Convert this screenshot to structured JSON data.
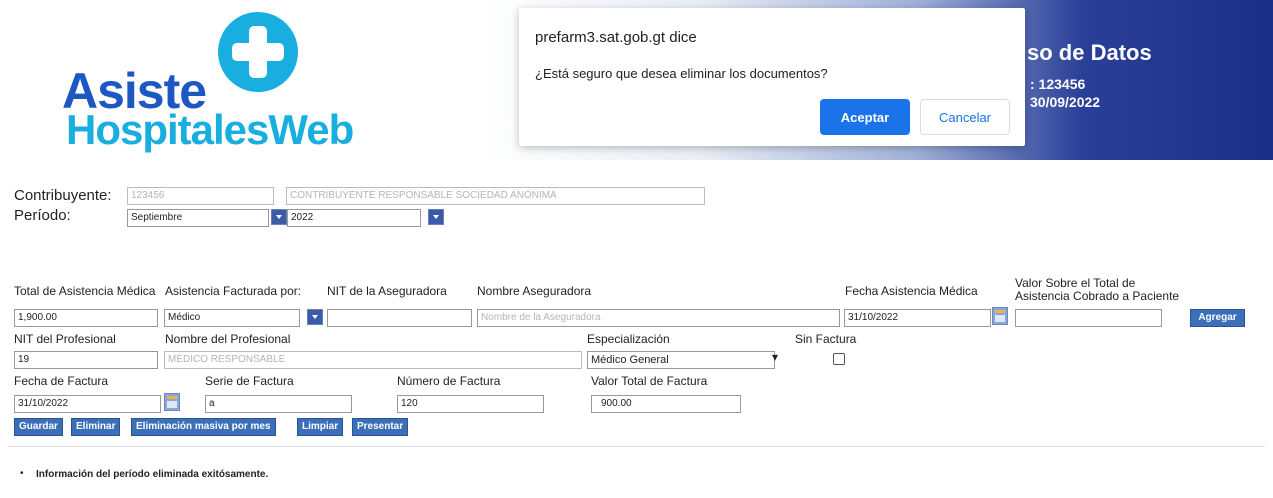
{
  "header": {
    "logo_line1": "Asiste",
    "logo_line2": "HospitalesWeb",
    "title_partial": "so de Datos",
    "line1_partial": ": 123456",
    "line2_partial": "30/09/2022"
  },
  "dialog": {
    "origin": "prefarm3.sat.gob.gt dice",
    "message": "¿Está seguro que desea eliminar los documentos?",
    "ok_label": "Aceptar",
    "cancel_label": "Cancelar"
  },
  "taxpayer": {
    "contribuyente_label": "Contribuyente:",
    "contribuyente_nit": "123456",
    "contribuyente_name": "CONTRIBUYENTE RESPONSABLE SOCIEDAD ANONIMA",
    "periodo_label": "Período:",
    "mes": "Septiembre",
    "anio": "2022"
  },
  "form": {
    "total_label": "Total de Asistencia Médica",
    "facturada_label": "Asistencia Facturada por:",
    "nit_aseg_label": "NIT de la Aseguradora",
    "nombre_aseg_label": "Nombre Aseguradora",
    "fecha_asist_label": "Fecha Asistencia Médica",
    "valor_sobre_label_1": "Valor Sobre el Total de",
    "valor_sobre_label_2": "Asistencia Cobrado a Paciente",
    "total_value": "1,900.00",
    "facturada_value": "Médico",
    "nit_aseg_value": "",
    "nombre_aseg_placeholder": "Nombre de la Aseguradora",
    "fecha_asist_value": "31/10/2022",
    "valor_sobre_value": "",
    "agregar_label": "Agregar",
    "nit_prof_label": "NIT del Profesional",
    "nombre_prof_label": "Nombre del Profesional",
    "especializacion_label": "Especialización",
    "sin_factura_label": "Sin Factura",
    "nit_prof_value": "19",
    "nombre_prof_value": "MÉDICO RESPONSABLE",
    "especializacion_value": "Médico General",
    "fecha_fact_label": "Fecha de Factura",
    "serie_label": "Serie de Factura",
    "numero_label": "Número de Factura",
    "valor_total_label": "Valor Total de Factura",
    "fecha_fact_value": "31/10/2022",
    "serie_value": "a",
    "numero_value": "120",
    "valor_total_value": "900.00"
  },
  "actions": {
    "guardar": "Guardar",
    "eliminar": "Eliminar",
    "eliminacion_masiva": "Eliminación masiva por mes",
    "limpiar": "Limpiar",
    "presentar": "Presentar"
  },
  "status": {
    "bullet": "•",
    "message": "Información del período eliminada exitósamente."
  }
}
